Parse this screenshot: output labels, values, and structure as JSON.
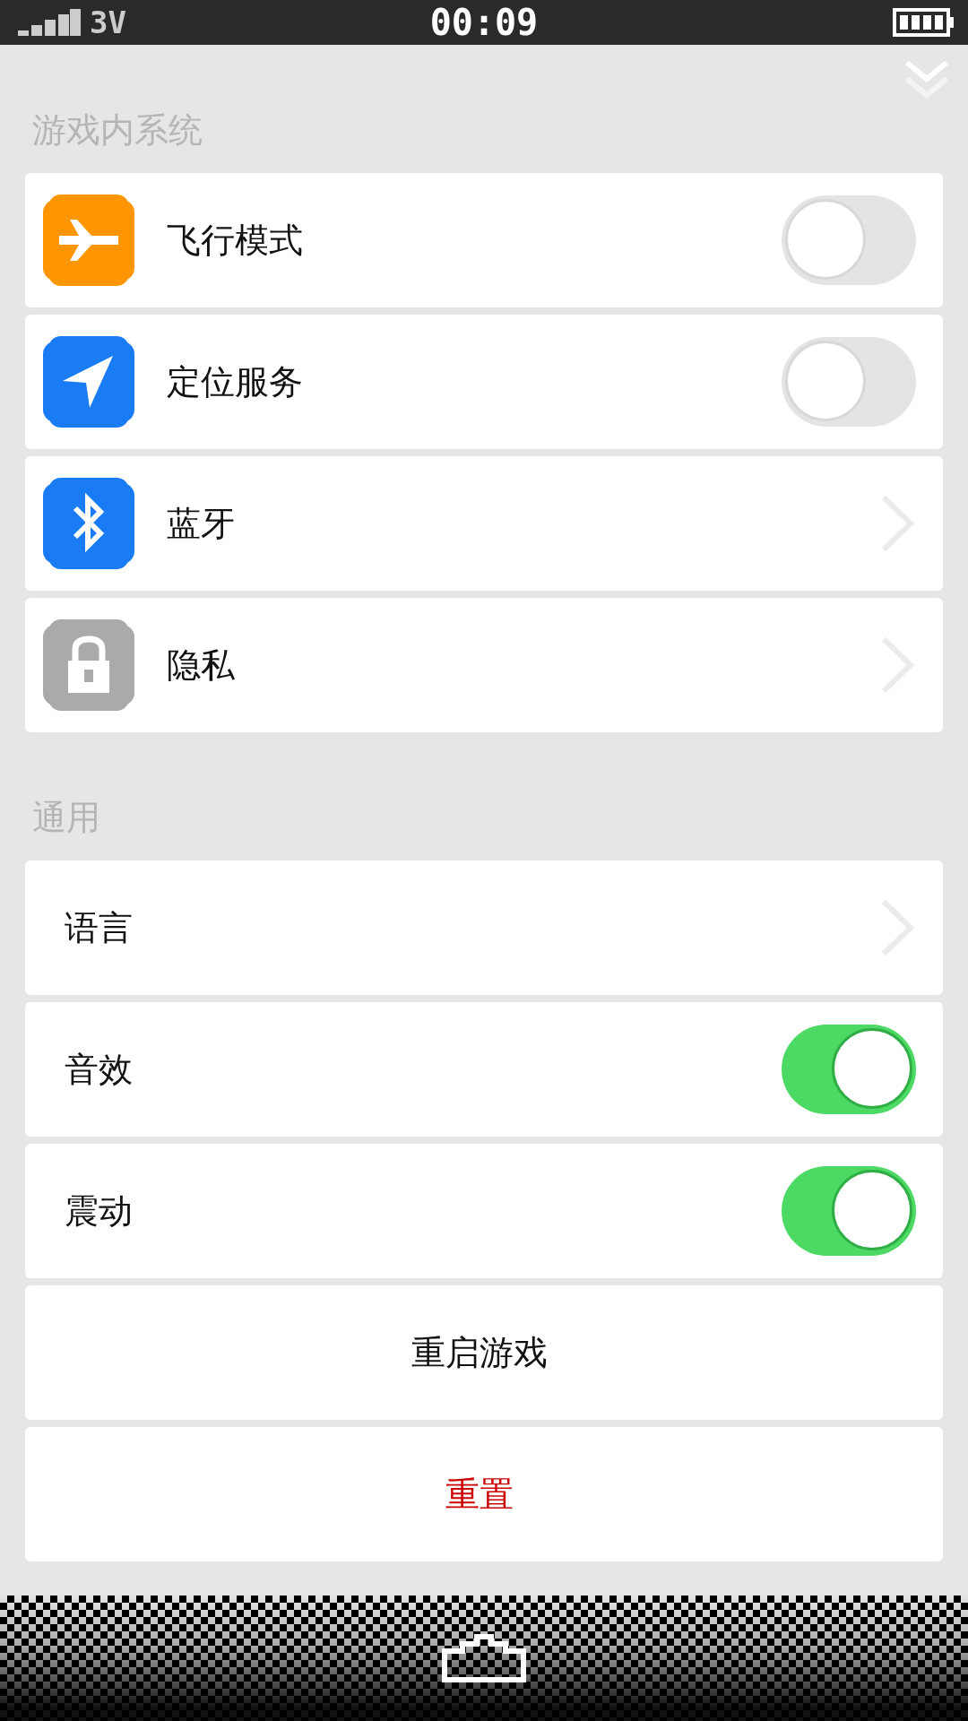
{
  "status_bar": {
    "network": "3V",
    "time": "00:09"
  },
  "sections": [
    {
      "title": "游戏内系统",
      "items": [
        {
          "kind": "toggle",
          "label": "飞行模式",
          "color": "#ff9500",
          "on": false
        },
        {
          "kind": "toggle",
          "label": "定位服务",
          "color": "#1a7cf5",
          "on": false
        },
        {
          "kind": "link",
          "label": "蓝牙",
          "color": "#1a7cf5"
        },
        {
          "kind": "link",
          "label": "隐私",
          "color": "#aaaaaa"
        }
      ]
    },
    {
      "title": "通用",
      "items": [
        {
          "kind": "link",
          "label": "语言"
        },
        {
          "kind": "toggle",
          "label": "音效",
          "on": true
        },
        {
          "kind": "toggle",
          "label": "震动",
          "on": true
        },
        {
          "kind": "button",
          "label": "重启游戏"
        },
        {
          "kind": "danger",
          "label": "重置"
        }
      ]
    }
  ]
}
